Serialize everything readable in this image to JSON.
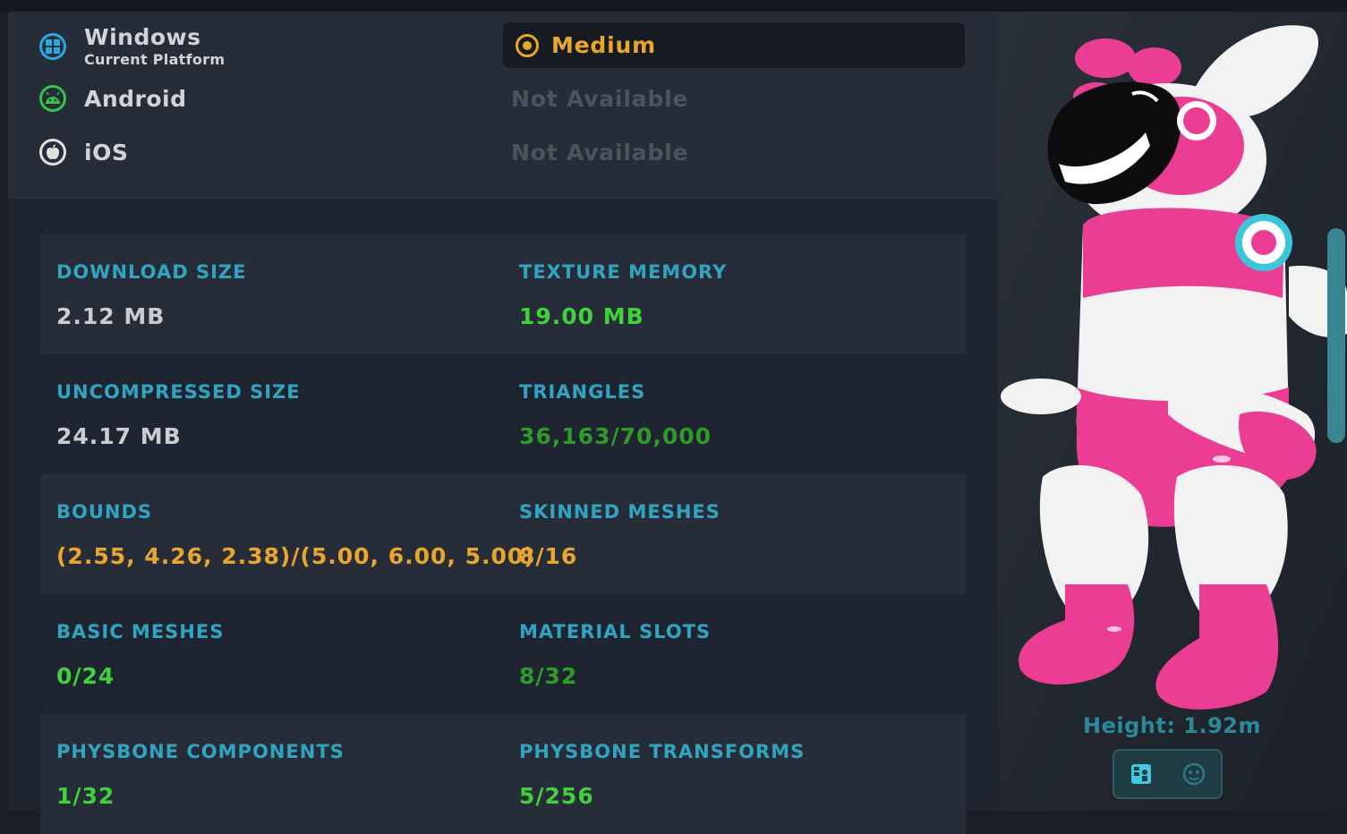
{
  "platforms": [
    {
      "name": "Windows",
      "subtitle": "Current Platform",
      "status": "Medium",
      "icon": "windows-icon",
      "color": "#2aa8e0"
    },
    {
      "name": "Android",
      "status": "Not Available",
      "icon": "android-icon",
      "color": "#35c34a"
    },
    {
      "name": "iOS",
      "status": "Not Available",
      "icon": "apple-icon",
      "color": "#e0e0e0"
    }
  ],
  "stats": [
    {
      "left": {
        "label": "DOWNLOAD SIZE",
        "value": "2.12 MB",
        "color": "#c8cdd2"
      },
      "right": {
        "label": "TEXTURE MEMORY",
        "value": "19.00 MB",
        "color": "#3fd23a"
      }
    },
    {
      "left": {
        "label": "UNCOMPRESSED SIZE",
        "value": "24.17 MB",
        "color": "#c8cdd2"
      },
      "right": {
        "label": "TRIANGLES",
        "value": "36,163/70,000",
        "color": "#2f9a2a"
      }
    },
    {
      "left": {
        "label": "BOUNDS",
        "value": "(2.55, 4.26, 2.38)/(5.00, 6.00, 5.00)",
        "color": "#e8a72c"
      },
      "right": {
        "label": "SKINNED MESHES",
        "value": "8/16",
        "color": "#e8a72c"
      }
    },
    {
      "left": {
        "label": "BASIC MESHES",
        "value": "0/24",
        "color": "#3fd23a"
      },
      "right": {
        "label": "MATERIAL SLOTS",
        "value": "8/32",
        "color": "#2f9a2a"
      }
    },
    {
      "left": {
        "label": "PHYSBONE COMPONENTS",
        "value": "1/32",
        "color": "#3fd23a"
      },
      "right": {
        "label": "PHYSBONE TRANSFORMS",
        "value": "5/256",
        "color": "#3fd23a"
      }
    }
  ],
  "preview": {
    "height_label": "Height: 1.92m",
    "buttons": [
      {
        "icon": "avatar-card-icon",
        "active": true
      },
      {
        "icon": "face-icon",
        "active": false
      }
    ]
  },
  "colors": {
    "label": "#2fa5c2",
    "accent": "#e8a72c",
    "good": "#3fd23a",
    "ok": "#2f9a2a"
  }
}
